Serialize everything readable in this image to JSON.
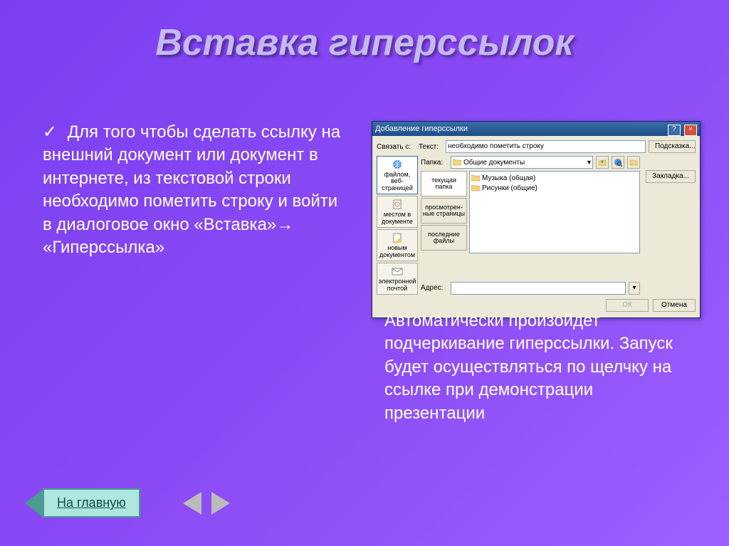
{
  "title": "Вставка гиперссылок",
  "bullet_text": " Для того чтобы сделать ссылку на внешний документ или документ в интернете,  из текстовой строки необходимо пометить строку   и войти в диалоговое окно «Вставка»→ «Гиперссылка»",
  "right_paragraph": "Автоматически произойдет подчеркивание гиперссылки. Запуск будет осуществляться по щелчку на ссылке при демонстрации презентации",
  "home_button": "На главную",
  "dialog": {
    "title": "Добавление гиперссылки",
    "link_label": "Связать с:",
    "text_label": "Текст:",
    "text_value": "необходимо пометить строку",
    "tooltip_btn": "Подсказка...",
    "folder_label": "Папка:",
    "folder_value": "Общие документы",
    "bookmark_btn": "Закладка...",
    "address_label": "Адрес:",
    "ok": "ОК",
    "cancel": "Отмена",
    "sidebar": [
      "файлом, веб-страницей",
      "местом в документе",
      "новым документом",
      "электронной почтой"
    ],
    "browse_tabs": [
      "текущая папка",
      "просмотрен-ные страницы",
      "последние файлы"
    ],
    "files": [
      "Музыка (общая)",
      "Рисунки (общие)"
    ]
  }
}
